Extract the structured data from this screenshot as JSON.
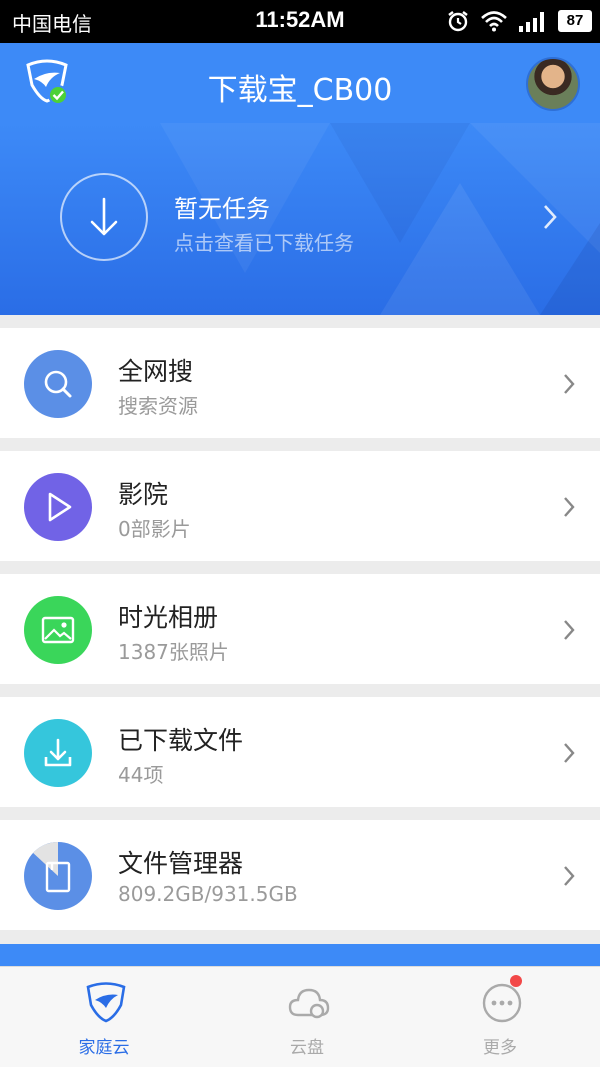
{
  "status_bar": {
    "carrier": "中国电信",
    "time": "11:52AM",
    "battery": "87"
  },
  "header": {
    "title": "下载宝_CB00",
    "logo_icon": "shield-bird-icon",
    "avatar_icon": "user-avatar"
  },
  "hero": {
    "title": "暂无任务",
    "subtitle": "点击查看已下载任务",
    "icon": "download-icon"
  },
  "items": [
    {
      "title": "全网搜",
      "subtitle": "搜索资源",
      "icon": "search-icon",
      "color": "#5b8fe6"
    },
    {
      "title": "影院",
      "subtitle": "0部影片",
      "icon": "play-icon",
      "color": "#7163e6"
    },
    {
      "title": "时光相册",
      "subtitle": "1387张照片",
      "icon": "image-icon",
      "color": "#3ad65a"
    },
    {
      "title": "已下载文件",
      "subtitle": "44项",
      "icon": "download-icon",
      "color": "#35c6dc"
    },
    {
      "title": "文件管理器",
      "subtitle": "809.2GB/931.5GB",
      "icon": "storage-pie-icon",
      "color": "#5b8fe6",
      "storage_used_fraction": 0.869
    }
  ],
  "tabs": [
    {
      "label": "家庭云",
      "icon": "home-cloud-icon",
      "active": true
    },
    {
      "label": "云盘",
      "icon": "cloud-icon",
      "active": false
    },
    {
      "label": "更多",
      "icon": "more-icon",
      "active": false
    }
  ],
  "colors": {
    "primary": "#3d8af7",
    "tab_active": "#2a6de6",
    "tab_inactive": "#aaaaaa"
  }
}
